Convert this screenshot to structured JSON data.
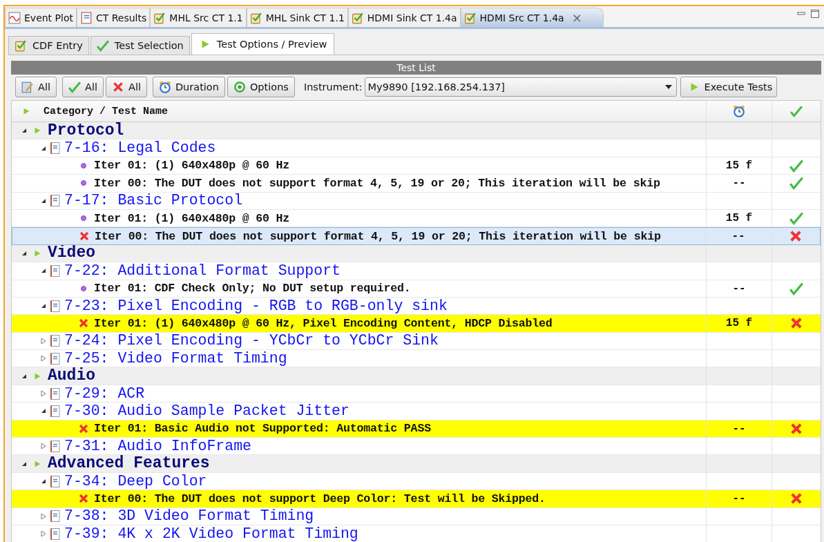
{
  "editor_tabs": [
    {
      "label": "Event Plot",
      "kind": "plot",
      "selected": false
    },
    {
      "label": "CT Results",
      "kind": "notebook",
      "selected": false
    },
    {
      "label": "MHL Src CT 1.1",
      "kind": "clipboard",
      "selected": false
    },
    {
      "label": "MHL Sink CT 1.1",
      "kind": "clipboard",
      "selected": false
    },
    {
      "label": "HDMI Sink CT 1.4a",
      "kind": "clipboard",
      "selected": false
    },
    {
      "label": "HDMI Src CT 1.4a",
      "kind": "clipboard",
      "selected": true,
      "close": "×"
    }
  ],
  "sub_tabs": [
    {
      "label": "CDF Entry",
      "kind": "clipboard",
      "selected": false
    },
    {
      "label": "Test Selection",
      "kind": "check",
      "selected": false
    },
    {
      "label": "Test Options / Preview",
      "kind": "play",
      "selected": true
    }
  ],
  "panel_title": "Test List",
  "toolbar": {
    "buttons": [
      {
        "kind": "edit",
        "label": "All"
      },
      {
        "kind": "check",
        "label": "All"
      },
      {
        "kind": "cross",
        "label": "All"
      },
      {
        "kind": "clock",
        "label": "Duration"
      },
      {
        "kind": "target",
        "label": "Options"
      }
    ],
    "instrument_label": "Instrument:",
    "instrument_value": "My9890 [192.168.254.137]",
    "execute": "Execute Tests"
  },
  "column_header": "Category / Test Name",
  "categories": [
    {
      "name": "Protocol",
      "expanded": true,
      "children": [
        {
          "name": "7-16: Legal Codes",
          "expanded": true,
          "children": [
            {
              "text": "Iter 01: (1) 640x480p @ 60 Hz",
              "failed": false,
              "duration": "15 f",
              "passed": true,
              "highlighted": false,
              "selected": false
            },
            {
              "text": "Iter 00: The DUT does not support format 4, 5, 19 or 20; This iteration will be skip",
              "failed": false,
              "duration": "--",
              "passed": true,
              "highlighted": false,
              "selected": false
            }
          ]
        },
        {
          "name": "7-17: Basic Protocol",
          "expanded": true,
          "children": [
            {
              "text": "Iter 01: (1) 640x480p @ 60 Hz",
              "failed": false,
              "duration": "15 f",
              "passed": true,
              "highlighted": false,
              "selected": false
            },
            {
              "text": "Iter 00: The DUT does not support format 4, 5, 19 or 20; This iteration will be skip",
              "failed": true,
              "duration": "--",
              "passed": false,
              "selected": true
            }
          ]
        }
      ]
    },
    {
      "name": "Video",
      "expanded": true,
      "children": [
        {
          "name": "7-22: Additional Format Support",
          "expanded": true,
          "children": [
            {
              "text": "Iter 01: CDF Check Only; No DUT setup required.",
              "failed": false,
              "duration": "--",
              "passed": true,
              "highlighted": false,
              "selected": false
            }
          ]
        },
        {
          "name": "7-23: Pixel Encoding - RGB to RGB-only sink",
          "expanded": true,
          "children": [
            {
              "text": "Iter 01: (1) 640x480p @ 60 Hz, Pixel Encoding Content, HDCP Disabled",
              "failed": true,
              "duration": "15 f",
              "passed": false,
              "highlighted": true,
              "selected": false
            }
          ]
        },
        {
          "name": "7-24: Pixel Encoding - YCbCr to YCbCr Sink",
          "expanded": false
        },
        {
          "name": "7-25: Video Format Timing",
          "expanded": false
        }
      ]
    },
    {
      "name": "Audio",
      "expanded": true,
      "children": [
        {
          "name": "7-29: ACR",
          "expanded": false
        },
        {
          "name": "7-30: Audio Sample Packet Jitter",
          "expanded": true,
          "children": [
            {
              "text": "Iter 01: Basic Audio not Supported: Automatic PASS",
              "failed": true,
              "duration": "--",
              "passed": false,
              "highlighted": true,
              "selected": false
            }
          ]
        },
        {
          "name": "7-31: Audio InfoFrame",
          "expanded": false
        }
      ]
    },
    {
      "name": "Advanced Features",
      "expanded": true,
      "children": [
        {
          "name": "7-34: Deep Color",
          "expanded": true,
          "children": [
            {
              "text": "Iter 00: The DUT does not support Deep Color: Test will be Skipped.",
              "failed": true,
              "duration": "--",
              "passed": false,
              "highlighted": true,
              "selected": false
            }
          ]
        },
        {
          "name": "7-38: 3D Video Format Timing",
          "expanded": false
        },
        {
          "name": "7-39: 4K x 2K Video Format Timing",
          "expanded": false
        }
      ]
    }
  ]
}
